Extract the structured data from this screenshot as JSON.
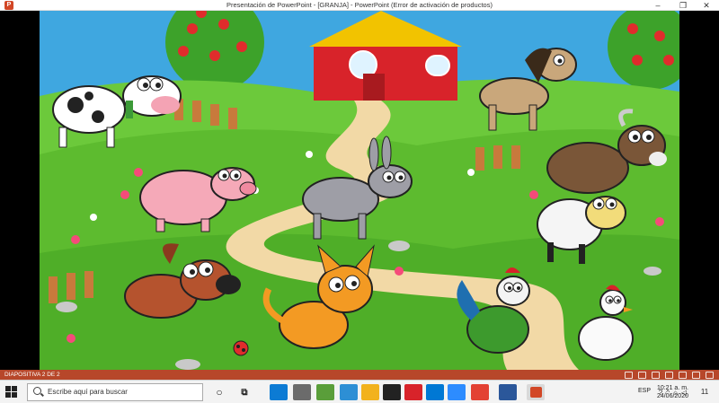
{
  "window": {
    "title": "Presentación de PowerPoint - [GRANJA] - PowerPoint (Error de activación de productos)",
    "app_logo": "P",
    "minimize": "–",
    "restore": "❐",
    "close": "✕"
  },
  "statusbar": {
    "slide_info": "DIAPOSITIVA 2 DE 2"
  },
  "taskbar": {
    "search_placeholder": "Escribe aquí para buscar",
    "lang": "ESP",
    "time": "10:21 a. m.",
    "date": "24/06/2020",
    "notifications": "11"
  },
  "colors": {
    "statusbar": "#b7472a",
    "sky": "#3fa7e0",
    "grass": "#5dbb2f",
    "barn": "#d8232a",
    "path": "#f2d9a6"
  }
}
